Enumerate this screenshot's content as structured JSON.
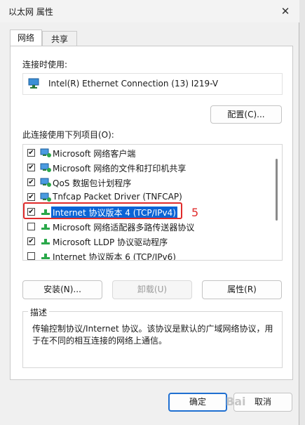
{
  "window": {
    "title": "以太网 属性"
  },
  "tabs": [
    {
      "label": "网络"
    },
    {
      "label": "共享"
    }
  ],
  "connect_using": {
    "label": "连接时使用:",
    "adapter": "Intel(R) Ethernet Connection (13) I219-V",
    "configure_button": "配置(C)..."
  },
  "items_section": {
    "label": "此连接使用下列项目(O):",
    "items": [
      {
        "label": "Microsoft 网络客户端",
        "checked": true,
        "icon": "network-client-icon"
      },
      {
        "label": "Microsoft 网络的文件和打印机共享",
        "checked": true,
        "icon": "network-client-icon"
      },
      {
        "label": "QoS 数据包计划程序",
        "checked": true,
        "icon": "network-client-icon"
      },
      {
        "label": "Tnfcap Packet Driver (TNFCAP)",
        "checked": true,
        "icon": "network-client-icon"
      },
      {
        "label": "Internet 协议版本 4 (TCP/IPv4)",
        "checked": true,
        "icon": "protocol-icon",
        "selected": true
      },
      {
        "label": "Microsoft 网络适配器多路传送器协议",
        "checked": false,
        "icon": "protocol-icon"
      },
      {
        "label": "Microsoft LLDP 协议驱动程序",
        "checked": true,
        "icon": "protocol-icon"
      },
      {
        "label": "Internet 协议版本 6 (TCP/IPv6)",
        "checked": false,
        "icon": "protocol-icon"
      }
    ]
  },
  "annotation": {
    "number": "5",
    "color": "#e02b2b"
  },
  "buttons": {
    "install": "安装(N)...",
    "uninstall": "卸载(U)",
    "properties": "属性(R)"
  },
  "description": {
    "label": "描述",
    "text": "传输控制协议/Internet 协议。该协议是默认的广域网络协议，用于在不同的相互连接的网络上通信。"
  },
  "footer": {
    "ok": "确定",
    "cancel": "取消"
  },
  "watermark": "Bai",
  "colors": {
    "selection": "#0a64d6",
    "accent": "#1f6fd1",
    "annotation": "#e02b2b"
  }
}
